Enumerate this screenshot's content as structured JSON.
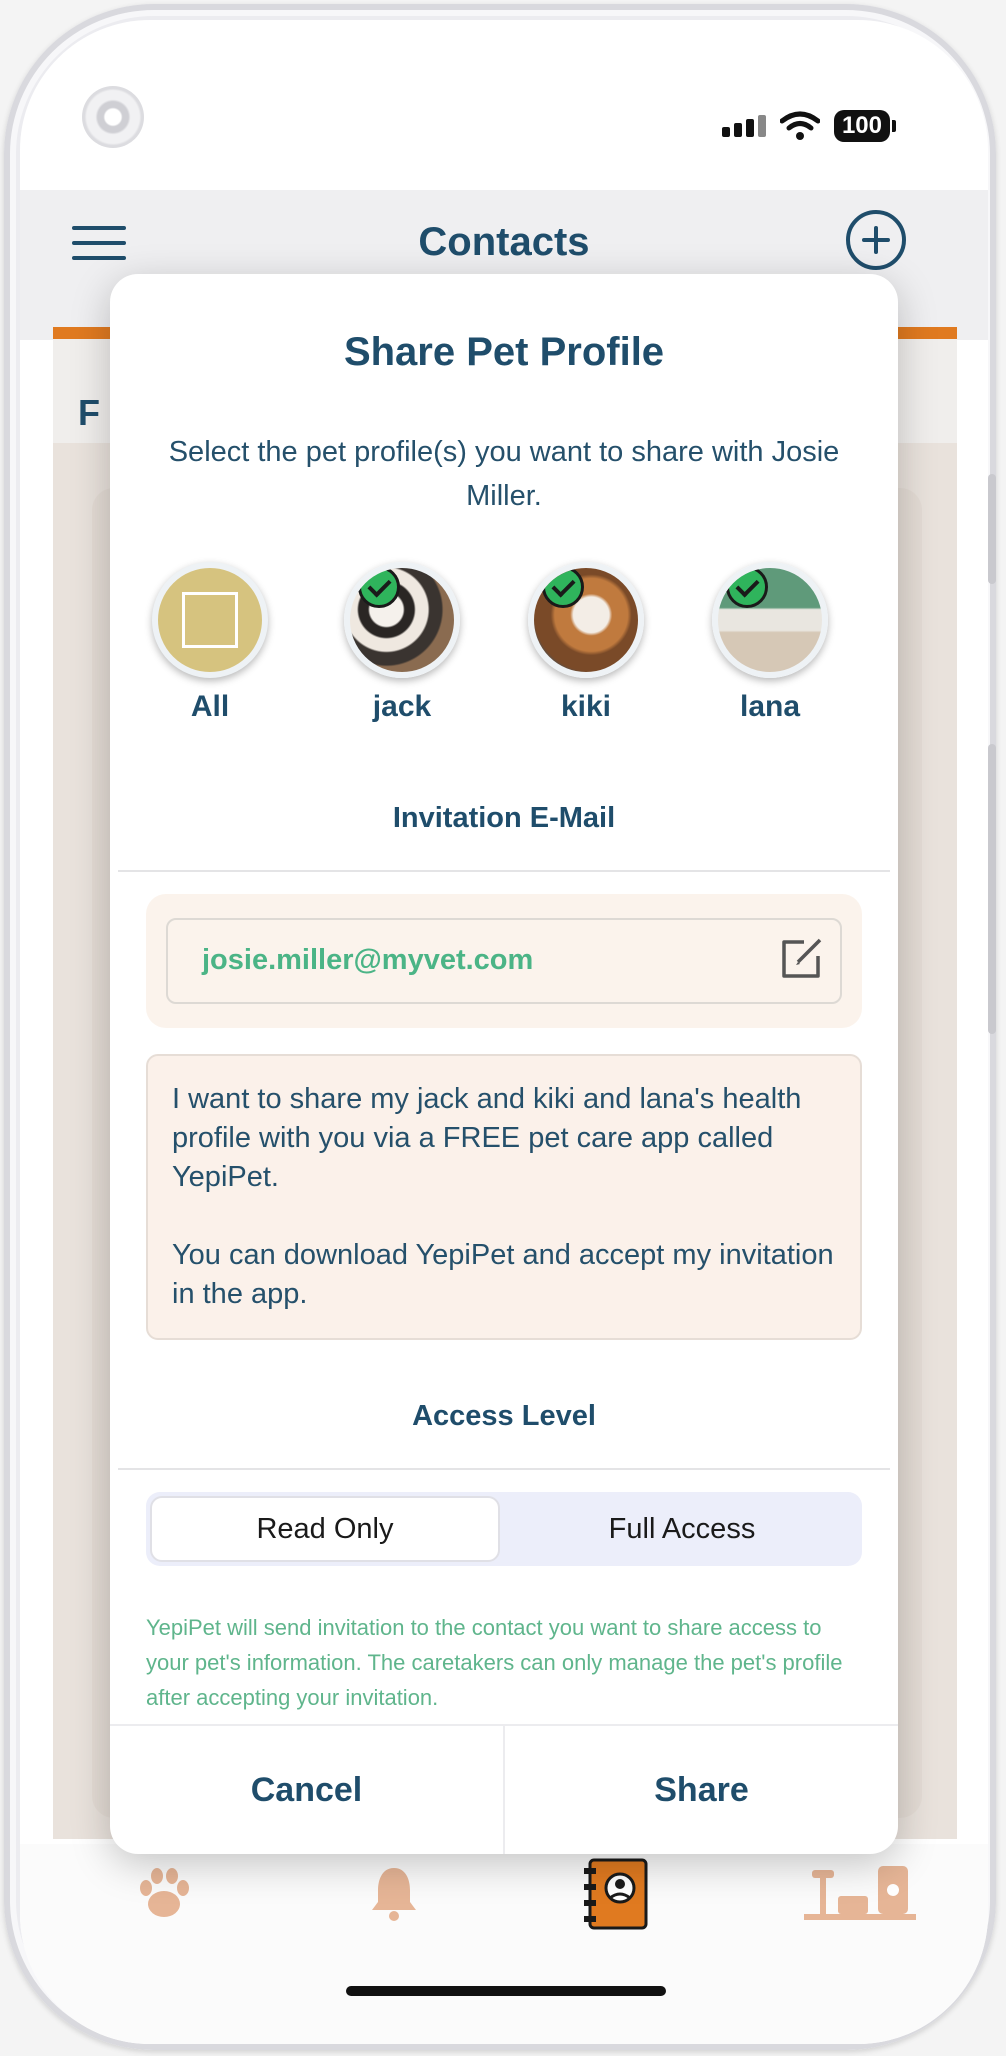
{
  "status_bar": {
    "battery": "100"
  },
  "background": {
    "title": "Contacts",
    "tab_letter": "F"
  },
  "modal": {
    "title": "Share Pet Profile",
    "description": "Select the pet profile(s) you want to share with Josie Miller.",
    "pets": [
      {
        "name": "All",
        "selected": false
      },
      {
        "name": "jack",
        "selected": true
      },
      {
        "name": "kiki",
        "selected": true
      },
      {
        "name": "lana",
        "selected": true
      }
    ],
    "email_section_title": "Invitation E-Mail",
    "email": "josie.miller@myvet.com",
    "message": "I want to share my jack and kiki and lana's health profile with you via a FREE pet care app called YepiPet.\n\nYou can download YepiPet and accept my invitation in the app.",
    "access_section_title": "Access Level",
    "access_options": [
      "Read Only",
      "Full Access"
    ],
    "access_selected": "Read Only",
    "note": "YepiPet will send invitation to the contact you want to share access to your pet's information. The caretakers can only manage the pet's profile after accepting your invitation.",
    "cancel_label": "Cancel",
    "share_label": "Share"
  },
  "colors": {
    "primary": "#1f4d6b",
    "accent": "#e07a20",
    "check": "#2fb45c",
    "note": "#5fb58c"
  }
}
